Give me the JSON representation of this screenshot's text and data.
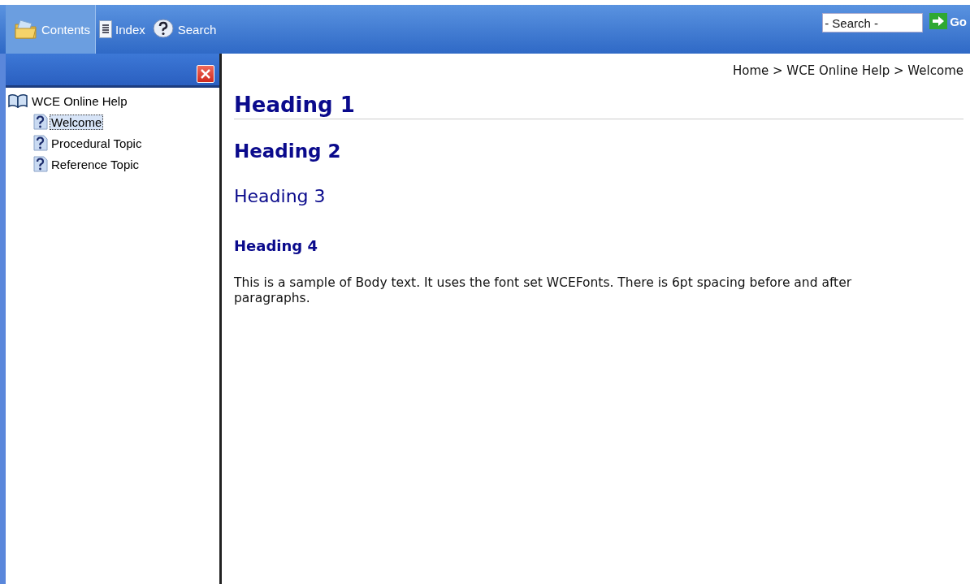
{
  "toolbar": {
    "tabs": [
      {
        "label": "Contents",
        "kind": "contents",
        "selected": true
      },
      {
        "label": "Index",
        "kind": "index",
        "selected": false
      },
      {
        "label": "Search",
        "kind": "search",
        "selected": false
      }
    ],
    "search": {
      "placeholder": "- Search -"
    },
    "go_button": "Go"
  },
  "tree": [
    {
      "label": "WCE Online Help",
      "kind": "book",
      "selected": false,
      "children": [
        {
          "label": "Welcome",
          "kind": "topic",
          "selected": true
        },
        {
          "label": "Procedural Topic",
          "kind": "topic",
          "selected": false
        },
        {
          "label": "Reference Topic",
          "kind": "topic",
          "selected": false
        }
      ]
    }
  ],
  "breadcrumb": "Home > WCE Online Help > Welcome",
  "content": [
    {
      "kind": "h1",
      "text": "Heading 1"
    },
    {
      "kind": "h2",
      "text": "Heading 2"
    },
    {
      "kind": "h3",
      "text": "Heading 3"
    },
    {
      "kind": "h4",
      "text": "Heading 4"
    },
    {
      "kind": "body",
      "text": "This is a sample of Body text. It uses the font set WCEFonts. There is 6pt spacing before and after paragraphs."
    }
  ]
}
